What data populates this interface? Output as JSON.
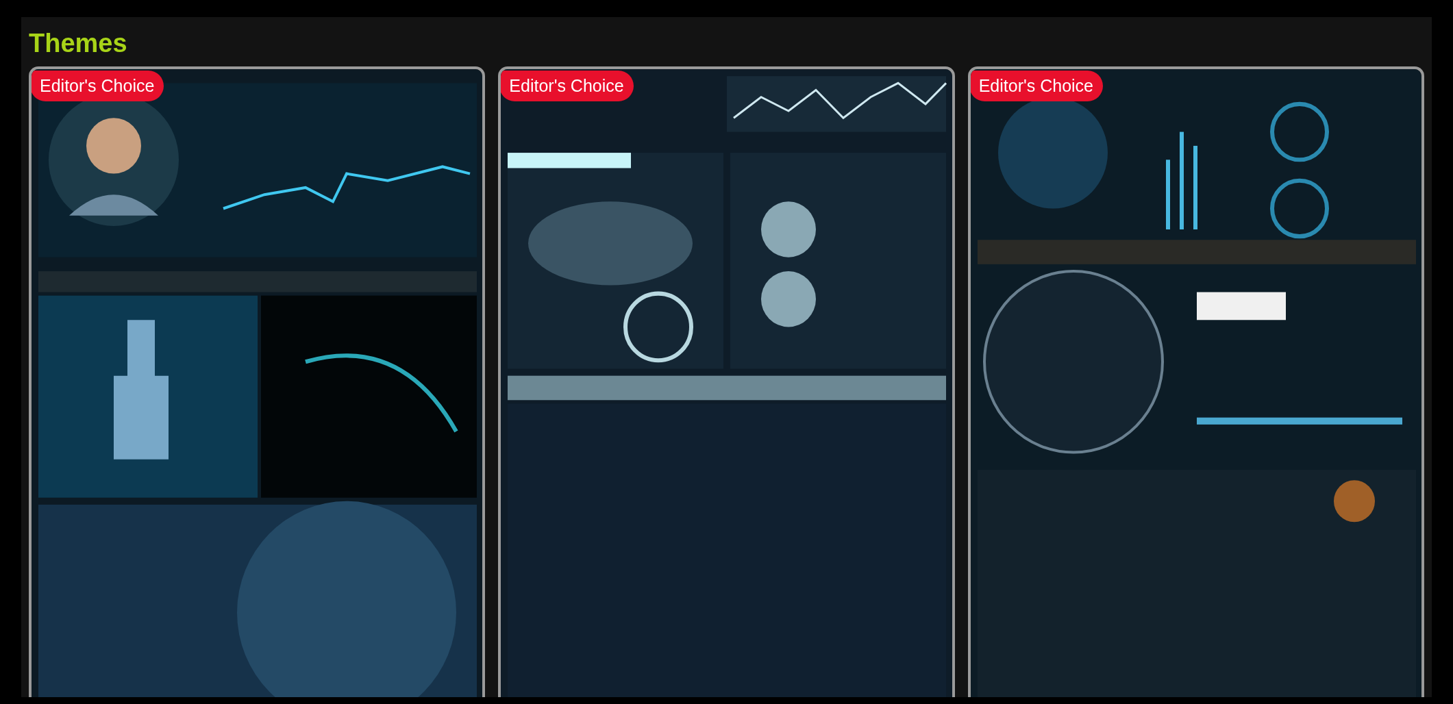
{
  "section": {
    "title": "Themes"
  },
  "themes": [
    {
      "badge": "Editor's Choice",
      "kind": "picture"
    },
    {
      "badge": "Editor's Choice",
      "kind": "picture"
    },
    {
      "badge": "Editor's Choice",
      "kind": "picture"
    }
  ]
}
